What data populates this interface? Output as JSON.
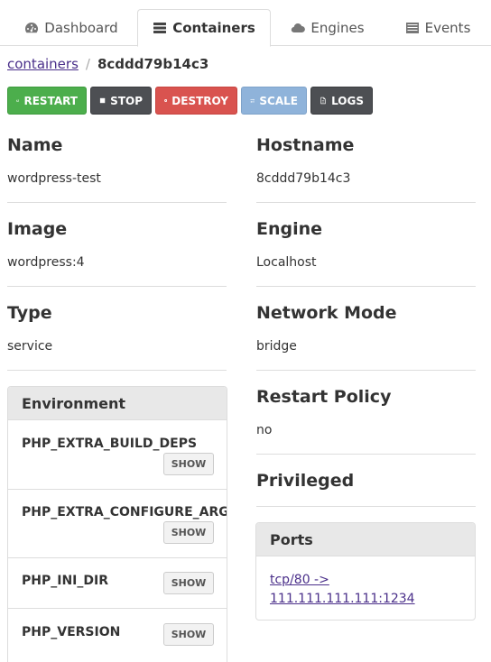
{
  "tabs": [
    {
      "label": "Dashboard",
      "icon": "dashboard-icon"
    },
    {
      "label": "Containers",
      "icon": "server-icon",
      "active": true
    },
    {
      "label": "Engines",
      "icon": "cloud-icon"
    },
    {
      "label": "Events",
      "icon": "list-icon"
    }
  ],
  "breadcrumb": {
    "parent": "containers",
    "separator": "/",
    "current": "8cddd79b14c3"
  },
  "actions": {
    "restart": "RESTART",
    "stop": "STOP",
    "destroy": "DESTROY",
    "scale": "SCALE",
    "logs": "LOGS"
  },
  "details": {
    "name": {
      "label": "Name",
      "value": "wordpress-test"
    },
    "hostname": {
      "label": "Hostname",
      "value": "8cddd79b14c3"
    },
    "image": {
      "label": "Image",
      "value": "wordpress:4"
    },
    "engine": {
      "label": "Engine",
      "value": "Localhost"
    },
    "type": {
      "label": "Type",
      "value": "service"
    },
    "network_mode": {
      "label": "Network Mode",
      "value": "bridge"
    },
    "restart_policy": {
      "label": "Restart Policy",
      "value": "no"
    },
    "privileged": {
      "label": "Privileged"
    }
  },
  "environment": {
    "title": "Environment",
    "show_label": "SHOW",
    "items": [
      "PHP_EXTRA_BUILD_DEPS",
      "PHP_EXTRA_CONFIGURE_ARGS",
      "PHP_INI_DIR",
      "PHP_VERSION"
    ]
  },
  "ports": {
    "title": "Ports",
    "link_line1": "tcp/80 ->",
    "link_line2": "111.111.111.111:1234"
  },
  "colors": {
    "restart": "#4cae4c",
    "stop": "#4d4f53",
    "destroy": "#d9534f",
    "scale": "#8fb3da",
    "logs": "#4d4f53",
    "link": "#4a2f8a"
  }
}
